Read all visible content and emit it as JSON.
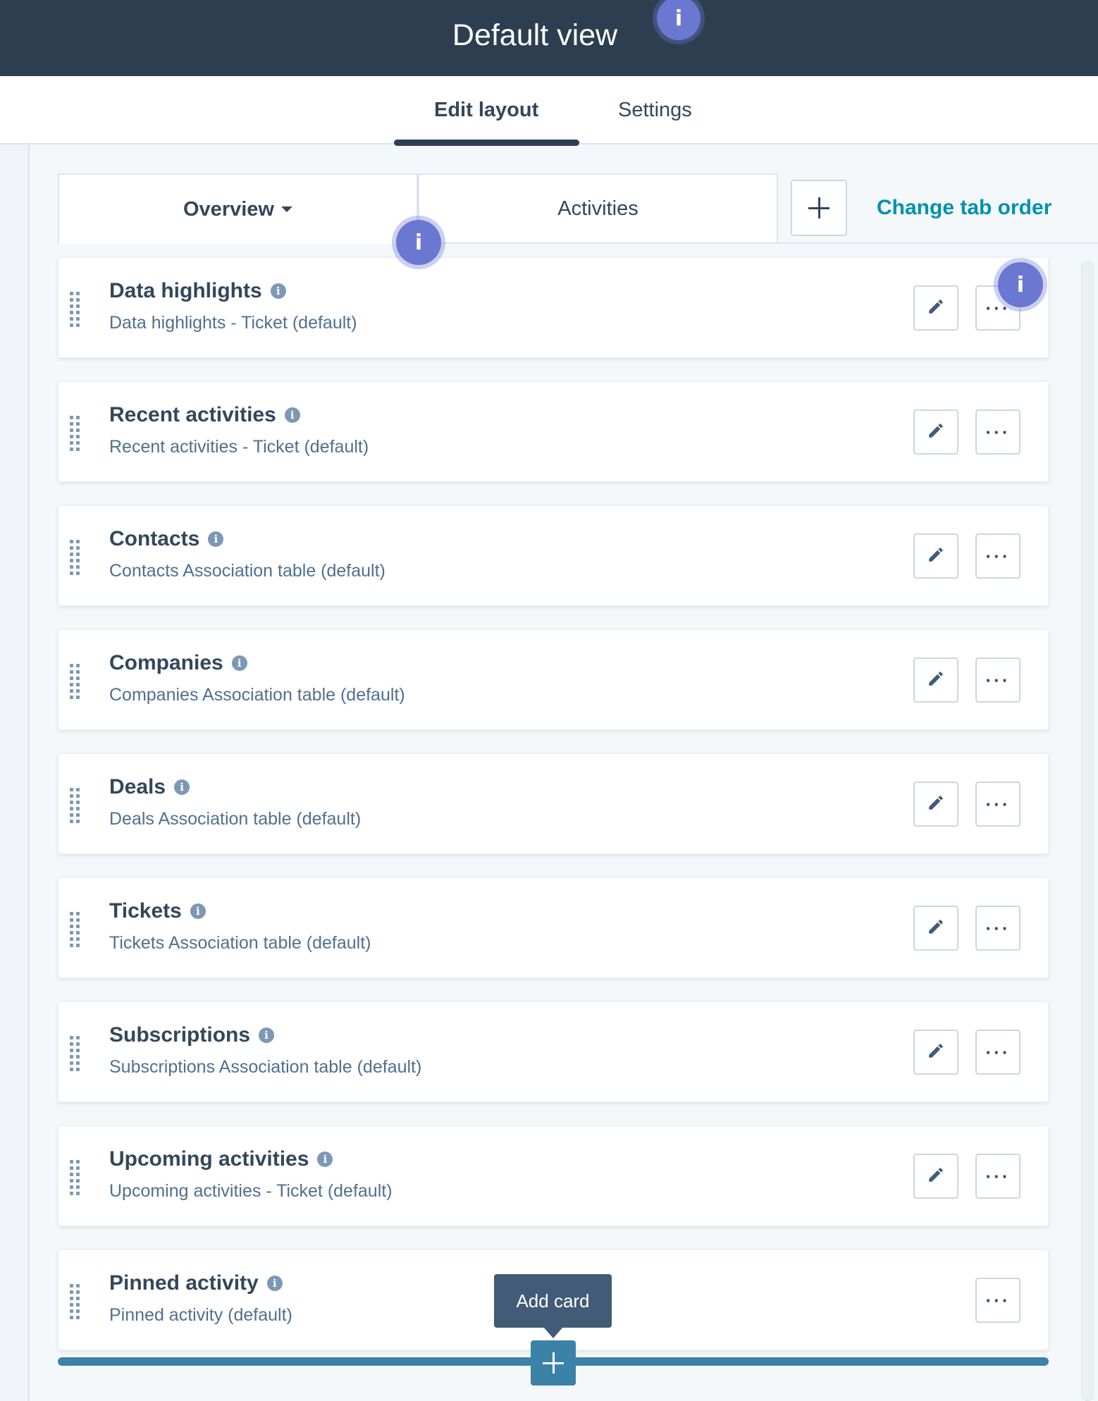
{
  "header": {
    "title": "Default view"
  },
  "page_tabs": [
    {
      "label": "Edit layout",
      "active": true
    },
    {
      "label": "Settings",
      "active": false
    }
  ],
  "record_tabs": [
    {
      "label": "Overview",
      "active": true,
      "has_dropdown": true
    },
    {
      "label": "Activities",
      "active": false
    }
  ],
  "add_tab_icon": "plus-icon",
  "change_tab_order_label": "Change tab order",
  "hotspot_label": "i",
  "info_icon": "info-icon",
  "cards": [
    {
      "title": "Data highlights",
      "subtitle": "Data highlights - Ticket (default)",
      "editable": true
    },
    {
      "title": "Recent activities",
      "subtitle": "Recent activities - Ticket (default)",
      "editable": true
    },
    {
      "title": "Contacts",
      "subtitle": "Contacts Association table (default)",
      "editable": true
    },
    {
      "title": "Companies",
      "subtitle": "Companies Association table (default)",
      "editable": true
    },
    {
      "title": "Deals",
      "subtitle": "Deals Association table (default)",
      "editable": true
    },
    {
      "title": "Tickets",
      "subtitle": "Tickets Association table (default)",
      "editable": true
    },
    {
      "title": "Subscriptions",
      "subtitle": "Subscriptions Association table (default)",
      "editable": true
    },
    {
      "title": "Upcoming activities",
      "subtitle": "Upcoming activities - Ticket (default)",
      "editable": true
    },
    {
      "title": "Pinned activity",
      "subtitle": "Pinned activity (default)",
      "editable": false
    }
  ],
  "add_card": {
    "tooltip": "Add card"
  },
  "colors": {
    "header_bg": "#2d3e50",
    "link": "#0091ae",
    "hotspot": "#6a78d1",
    "drop_indicator": "#3a82a8"
  }
}
